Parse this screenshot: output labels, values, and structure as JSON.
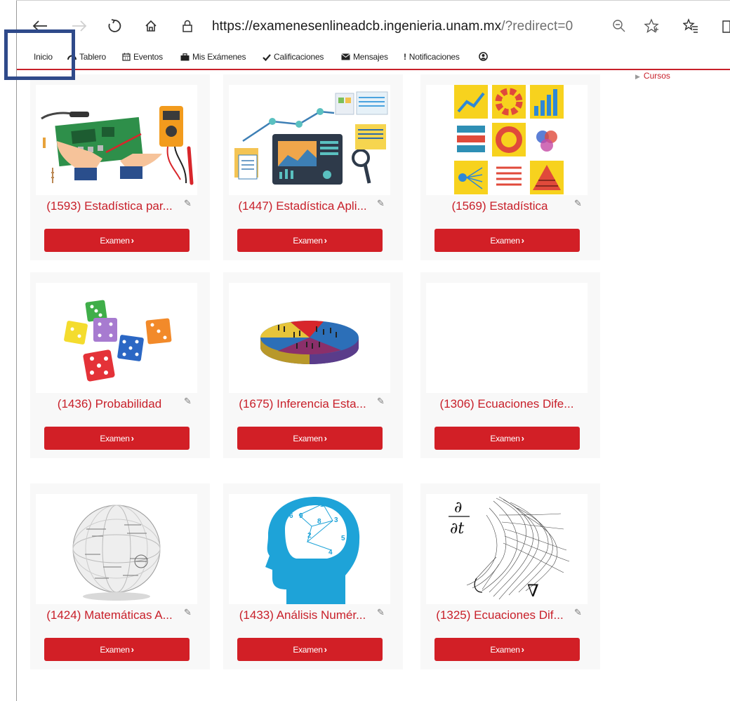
{
  "browser": {
    "url_main": "https://examenesenlineadcb.ingenieria.unam.mx",
    "url_rest": "/?redirect=0",
    "icons": [
      "back-arrow-icon",
      "forward-arrow-icon",
      "refresh-icon",
      "home-icon",
      "lock-icon",
      "zoom-icon",
      "star-icon",
      "favorites-icon"
    ]
  },
  "nav": {
    "items": [
      {
        "label": "Inicio",
        "icon": ""
      },
      {
        "label": "Tablero",
        "icon": "dashboard-icon"
      },
      {
        "label": "Eventos",
        "icon": "calendar-icon"
      },
      {
        "label": "Mis Exámenes",
        "icon": "briefcase-icon"
      },
      {
        "label": "Calificaciones",
        "icon": "check-icon"
      },
      {
        "label": "Mensajes",
        "icon": "envelope-icon"
      },
      {
        "label": "Notificaciones",
        "icon": "exclamation-icon"
      }
    ]
  },
  "sidebar": {
    "cursos_label": "Cursos"
  },
  "colors": {
    "accent": "#d21f26",
    "link": "#c8202a",
    "card_bg": "#f8f8f8",
    "highlight": "#2f4a8a"
  },
  "courses": [
    {
      "title": "(1593) Estadística par...",
      "button": "Examen",
      "image": "electronics-illustration"
    },
    {
      "title": "(1447) Estadística Apli...",
      "button": "Examen",
      "image": "dashboard-illustration"
    },
    {
      "title": "(1569) Estadística",
      "button": "Examen",
      "image": "infographic-tiles"
    },
    {
      "title": "(1436) Probabilidad",
      "button": "Examen",
      "image": "dice-illustration"
    },
    {
      "title": "(1675) Inferencia Esta...",
      "button": "Examen",
      "image": "pie-people-illustration"
    },
    {
      "title": "(1306) Ecuaciones Dife...",
      "button": "Examen",
      "image": ""
    },
    {
      "title": "(1424) Matemáticas A...",
      "button": "Examen",
      "image": "formula-sphere"
    },
    {
      "title": "(1433) Análisis Numér...",
      "button": "Examen",
      "image": "head-numbers"
    },
    {
      "title": "(1325) Ecuaciones Dif...",
      "button": "Examen",
      "image": "flow-lines-partial-derivative"
    }
  ],
  "math_labels": {
    "partial": "∂",
    "dt": "∂t",
    "nabla": "∇"
  },
  "head_numbers": [
    "1",
    "6",
    "9",
    "8",
    "3",
    "2",
    "5",
    "4"
  ]
}
